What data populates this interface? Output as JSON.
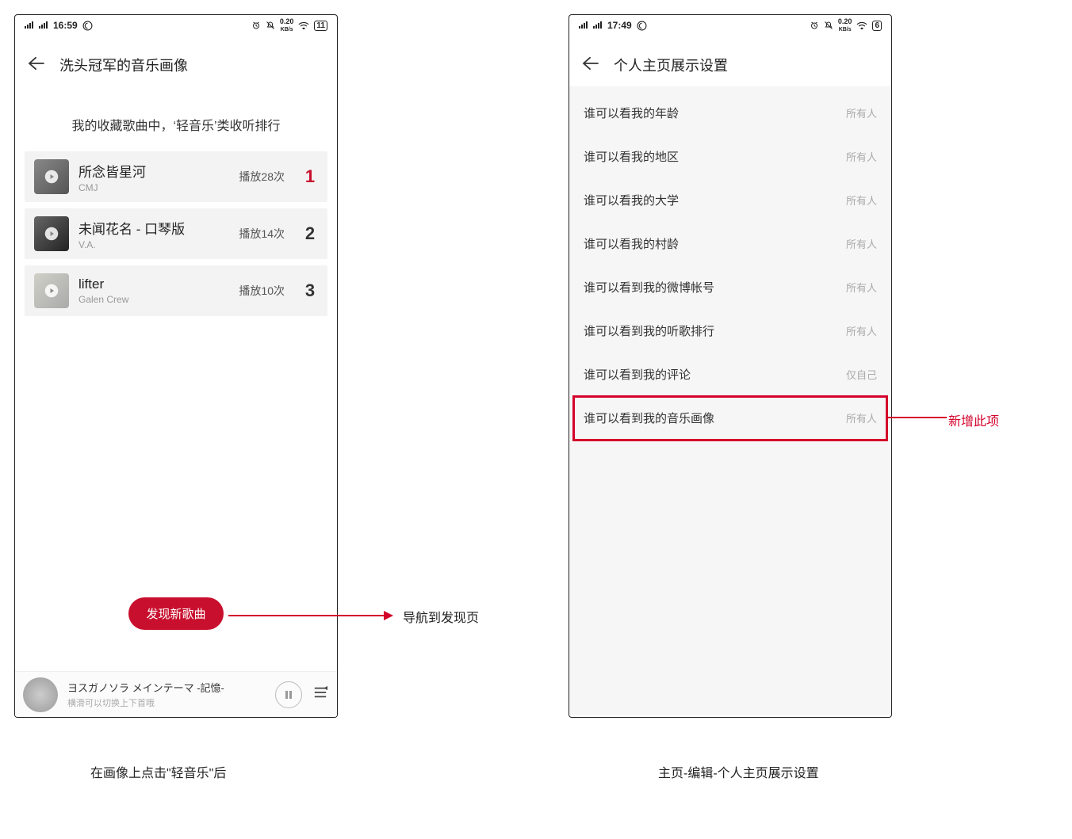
{
  "left": {
    "status": {
      "time": "16:59",
      "net": "0.20",
      "net_unit": "KB/s",
      "batt": "11"
    },
    "header_title": "洗头冠军的音乐画像",
    "rank_caption": "我的收藏歌曲中，‘轻音乐’类收听排行",
    "songs": [
      {
        "title": "所念皆星河",
        "artist": "CMJ",
        "plays": "播放28次",
        "rank": "1"
      },
      {
        "title": "未闻花名 - 口琴版",
        "artist": "V.A.",
        "plays": "播放14次",
        "rank": "2"
      },
      {
        "title": "lifter",
        "artist": "Galen Crew",
        "plays": "播放10次",
        "rank": "3"
      }
    ],
    "discover_label": "发现新歌曲",
    "player": {
      "title": "ヨスガノソラ メインテーマ -記憶-",
      "sub": "横滑可以切换上下首哦"
    },
    "caption_below": "在画像上点击\"轻音乐\"后",
    "arrow_label": "导航到发现页"
  },
  "right": {
    "status": {
      "time": "17:49",
      "net": "0.20",
      "net_unit": "KB/s",
      "batt": "6"
    },
    "header_title": "个人主页展示设置",
    "settings": [
      {
        "label": "谁可以看我的年龄",
        "value": "所有人"
      },
      {
        "label": "谁可以看我的地区",
        "value": "所有人"
      },
      {
        "label": "谁可以看我的大学",
        "value": "所有人"
      },
      {
        "label": "谁可以看我的村龄",
        "value": "所有人"
      },
      {
        "label": "谁可以看到我的微博帐号",
        "value": "所有人"
      },
      {
        "label": "谁可以看到我的听歌排行",
        "value": "所有人"
      },
      {
        "label": "谁可以看到我的评论",
        "value": "仅自己"
      },
      {
        "label": "谁可以看到我的音乐画像",
        "value": "所有人"
      }
    ],
    "caption_below": "主页-编辑-个人主页展示设置",
    "highlight_label": "新增此项"
  }
}
